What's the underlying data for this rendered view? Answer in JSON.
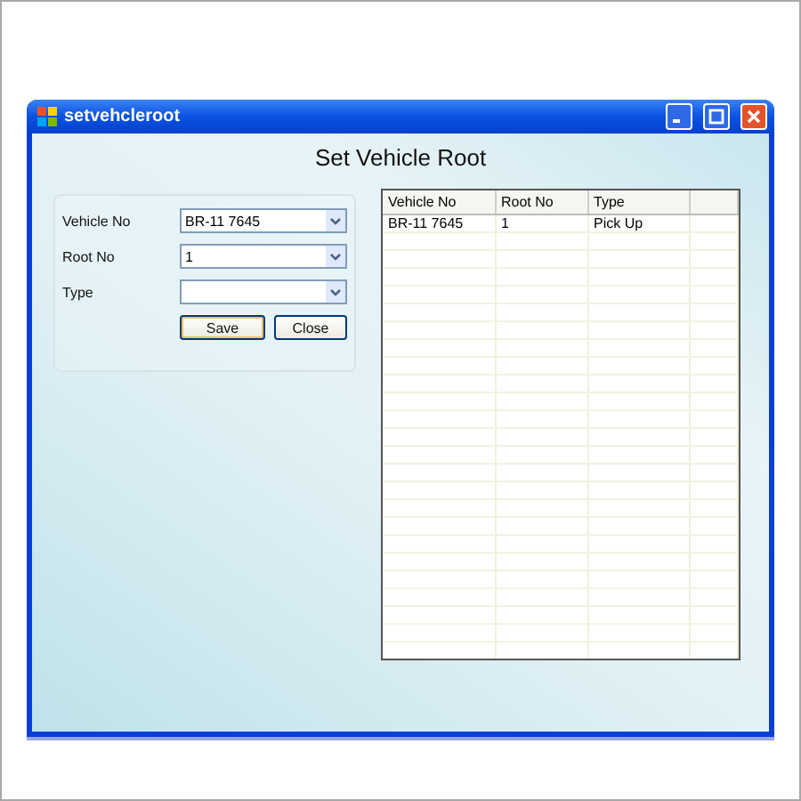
{
  "window": {
    "title": "setvehcleroot"
  },
  "heading": "Set Vehicle Root",
  "form": {
    "fields": [
      {
        "label": "Vehicle No",
        "value": "BR-11 7645"
      },
      {
        "label": "Root No",
        "value": "1"
      },
      {
        "label": "Type"
      }
    ],
    "buttons": [
      {
        "label": "Save",
        "focused": true
      },
      {
        "label": "Close",
        "focused": false
      }
    ]
  },
  "table": {
    "columns": [
      "Vehicle No",
      "Root No",
      "Type"
    ],
    "rows": [
      [
        "BR-11 7645",
        "1",
        "Pick Up"
      ]
    ]
  }
}
